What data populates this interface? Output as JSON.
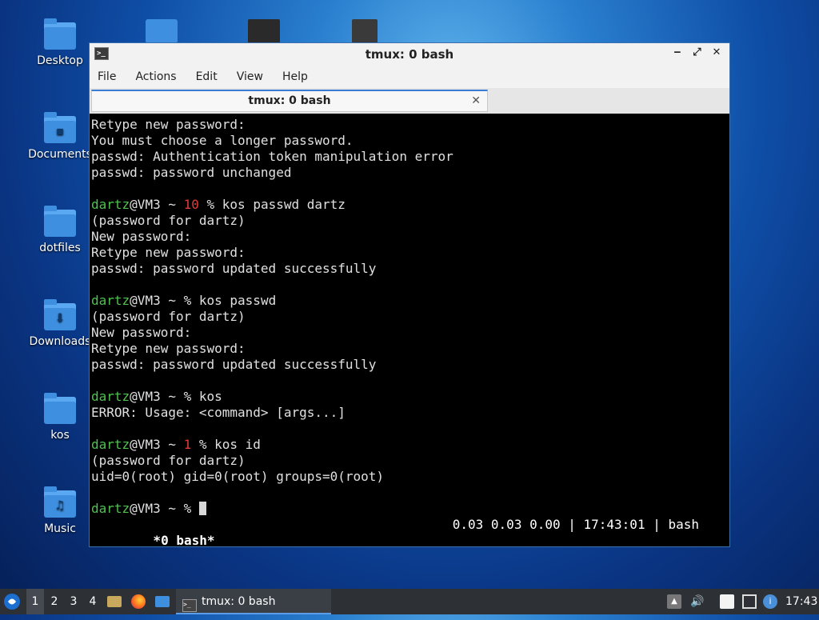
{
  "desktop": {
    "icons": [
      {
        "label": "Desktop",
        "glyph": ""
      },
      {
        "label": "Documents",
        "glyph": "▪"
      },
      {
        "label": "dotfiles",
        "glyph": ""
      },
      {
        "label": "Downloads",
        "glyph": "⬇"
      },
      {
        "label": "kos",
        "glyph": ""
      },
      {
        "label": "Music",
        "glyph": "♫"
      }
    ]
  },
  "window": {
    "title": "tmux: 0 bash",
    "buttons": {
      "minimize": "‒",
      "maximize": "⤢",
      "close": "✕"
    },
    "menu": [
      "File",
      "Actions",
      "Edit",
      "View",
      "Help"
    ],
    "tab": {
      "label": "tmux: 0 bash",
      "close": "✕"
    }
  },
  "terminal": {
    "lines": [
      "Retype new password:",
      "You must choose a longer password.",
      "passwd: Authentication token manipulation error",
      "passwd: password unchanged",
      "",
      "",
      "(password for dartz)",
      "New password:",
      "Retype new password:",
      "passwd: password updated successfully",
      "",
      "",
      "(password for dartz)",
      "New password:",
      "Retype new password:",
      "passwd: password updated successfully",
      "",
      "",
      "ERROR: Usage: <command> [args...]",
      "",
      "",
      "(password for dartz)",
      "uid=0(root) gid=0(root) groups=0(root)",
      "",
      ""
    ],
    "prompts": {
      "user": "dartz",
      "host": "@VM3 ~ ",
      "p1": {
        "code": "10 ",
        "cmd": "% kos passwd dartz"
      },
      "p2": {
        "code": "",
        "cmd": "% kos passwd"
      },
      "p3": {
        "code": "",
        "cmd": "% kos"
      },
      "p4": {
        "code": "1 ",
        "cmd": "% kos id"
      },
      "p5": {
        "code": "",
        "cmd": "% "
      }
    },
    "status_left": " *0 bash*",
    "status_right": "0.03 0.03 0.00 | 17:43:01 | bash"
  },
  "taskbar": {
    "workspaces": [
      "1",
      "2",
      "3",
      "4"
    ],
    "active_workspace": "1",
    "task_label": "tmux: 0 bash",
    "clock": "17:43"
  }
}
